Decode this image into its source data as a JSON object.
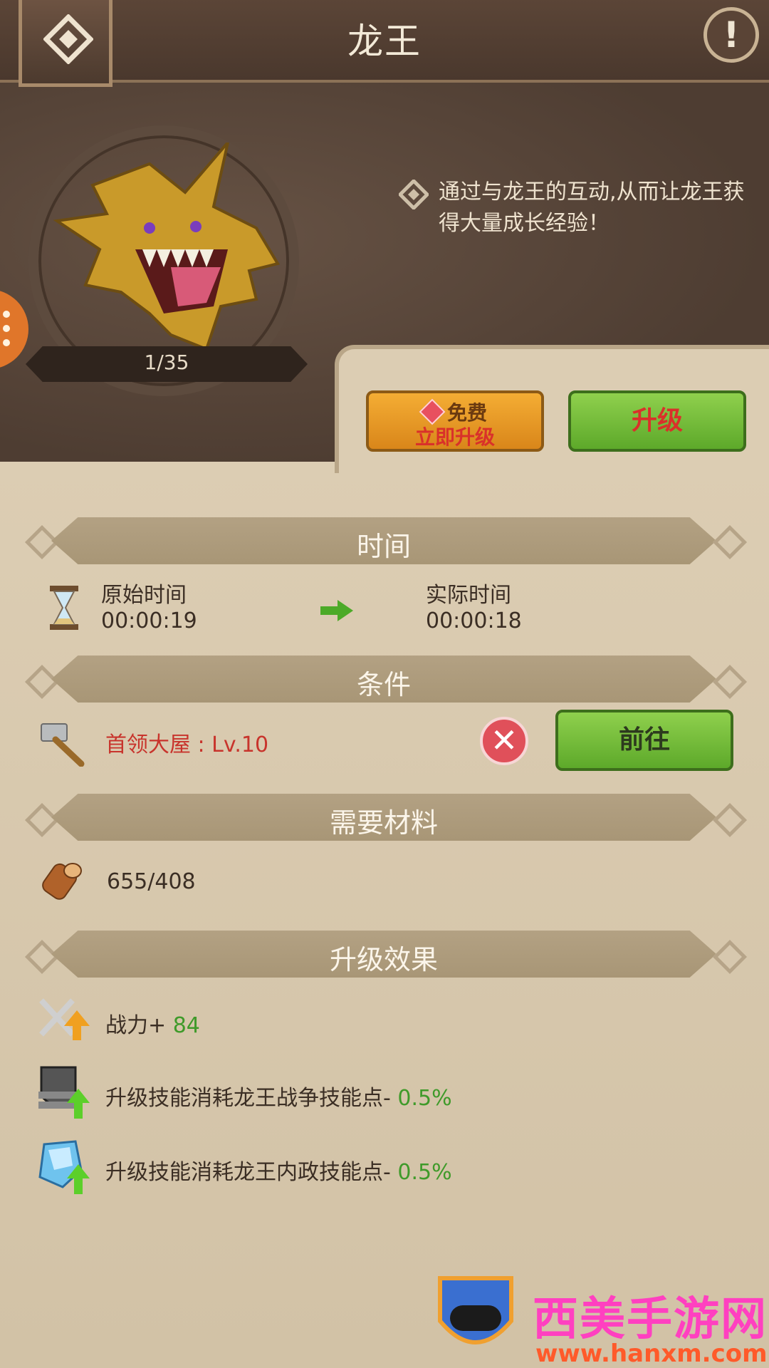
{
  "header": {
    "title": "龙王",
    "back_icon": "back-diamond-icon",
    "info_icon": "exclamation-icon",
    "info_glyph": "!"
  },
  "dragon": {
    "counter": "1/35",
    "description": "通过与龙王的互动,从而让龙王获得大量成长经验！"
  },
  "actions": {
    "instant": {
      "free_label": "免费",
      "action_label": "立即升级"
    },
    "upgrade_label": "升级"
  },
  "time_section": {
    "title": "时间",
    "original_label": "原始时间",
    "original_value": "00:00:19",
    "actual_label": "实际时间",
    "actual_value": "00:00:18"
  },
  "condition_section": {
    "title": "条件",
    "requirement": "首领大屋 : Lv.10",
    "go_label": "前往",
    "status_glyph": "✕"
  },
  "materials_section": {
    "title": "需要材料",
    "wood": "655/408"
  },
  "effects_section": {
    "title": "升级效果",
    "items": [
      {
        "label": "战力+ ",
        "value": "84"
      },
      {
        "label": "升级技能消耗龙王战争技能点- ",
        "value": "0.5%"
      },
      {
        "label": "升级技能消耗龙王内政技能点- ",
        "value": "0.5%"
      }
    ]
  },
  "watermark": {
    "brand": "西美手游网",
    "url": "www.hanxm.com"
  },
  "colors": {
    "accent_green": "#5da92a",
    "accent_orange": "#d9861a",
    "text_red": "#c8342c"
  }
}
